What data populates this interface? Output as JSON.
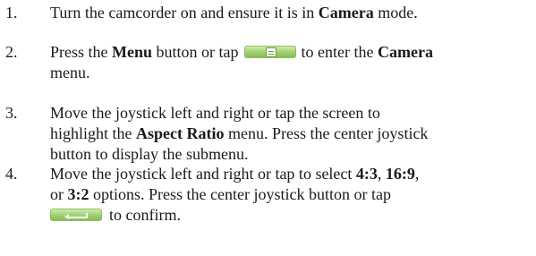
{
  "steps": [
    {
      "number": "1.",
      "parts": [
        "Turn the camcorder on and ensure it is in ",
        "Camera",
        " mode."
      ]
    },
    {
      "number": "2.",
      "parts": [
        "Press the ",
        "Menu",
        " button or tap",
        "to enter the ",
        "Camera",
        "menu."
      ],
      "icon": "menu-icon"
    },
    {
      "number": "3.",
      "parts": [
        "Move the joystick left and right or tap the screen to",
        "highlight the ",
        "Aspect Ratio",
        " menu. Press the center joystick",
        "button to display the submenu."
      ]
    },
    {
      "number": "4.",
      "parts": [
        "Move the joystick left and right or tap to select ",
        "4:3",
        ", ",
        "16:9",
        ",",
        "or ",
        "3:2",
        " options. Press the center joystick button or tap",
        "to confirm."
      ],
      "icon": "enter-icon"
    }
  ],
  "colors": {
    "text": "#1a1a1a",
    "icon_green": "#a8d47a"
  }
}
